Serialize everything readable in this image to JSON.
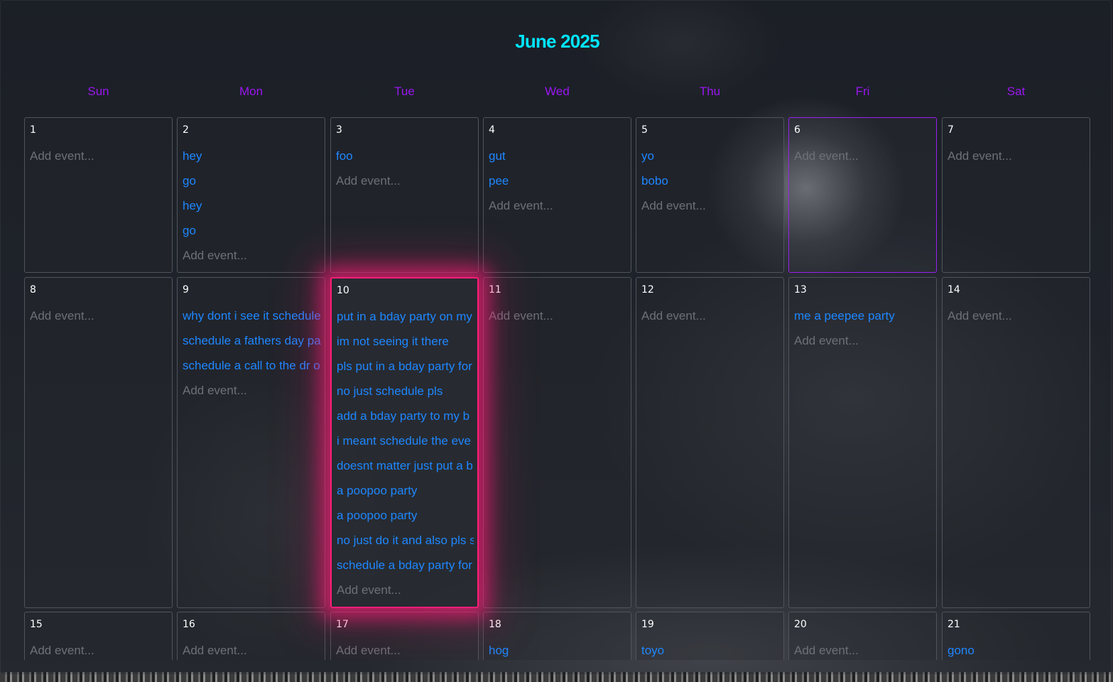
{
  "calendar": {
    "title": "June 2025",
    "weekdays": [
      "Sun",
      "Mon",
      "Tue",
      "Wed",
      "Thu",
      "Fri",
      "Sat"
    ],
    "add_placeholder": "Add event...",
    "today": "6",
    "selected": "10",
    "weeks": [
      [
        {
          "day": "1",
          "events": []
        },
        {
          "day": "2",
          "events": [
            "hey",
            "go",
            "hey",
            "go"
          ]
        },
        {
          "day": "3",
          "events": [
            "foo"
          ]
        },
        {
          "day": "4",
          "events": [
            "gut",
            "pee"
          ]
        },
        {
          "day": "5",
          "events": [
            "yo",
            "bobo"
          ]
        },
        {
          "day": "6",
          "events": []
        },
        {
          "day": "7",
          "events": []
        }
      ],
      [
        {
          "day": "8",
          "events": []
        },
        {
          "day": "9",
          "events": [
            "why dont i see it schedule",
            "schedule a fathers day pa",
            "schedule a call to the dr o"
          ]
        },
        {
          "day": "10",
          "events": [
            "put in a bday party on my",
            "im not seeing it there",
            "pls put in a bday party for",
            "no just schedule pls",
            "add a bday party to my b",
            "i meant schedule the eve",
            "doesnt matter just put a b",
            "a poopoo party",
            "a poopoo party",
            "no just do it and also pls s",
            "schedule a bday party for"
          ]
        },
        {
          "day": "11",
          "events": []
        },
        {
          "day": "12",
          "events": []
        },
        {
          "day": "13",
          "events": [
            "me a peepee party"
          ]
        },
        {
          "day": "14",
          "events": []
        }
      ],
      [
        {
          "day": "15",
          "events": []
        },
        {
          "day": "16",
          "events": []
        },
        {
          "day": "17",
          "events": []
        },
        {
          "day": "18",
          "events": [
            "hog"
          ]
        },
        {
          "day": "19",
          "events": [
            "toyo"
          ]
        },
        {
          "day": "20",
          "events": []
        },
        {
          "day": "21",
          "events": [
            "gono"
          ]
        }
      ]
    ]
  },
  "colors": {
    "title": "#00e5ff",
    "weekday": "#9a16f0",
    "event": "#1e87ff",
    "placeholder": "#6d7078",
    "today_border": "#9a1ff0",
    "selected_glow": "#ff1d78"
  }
}
